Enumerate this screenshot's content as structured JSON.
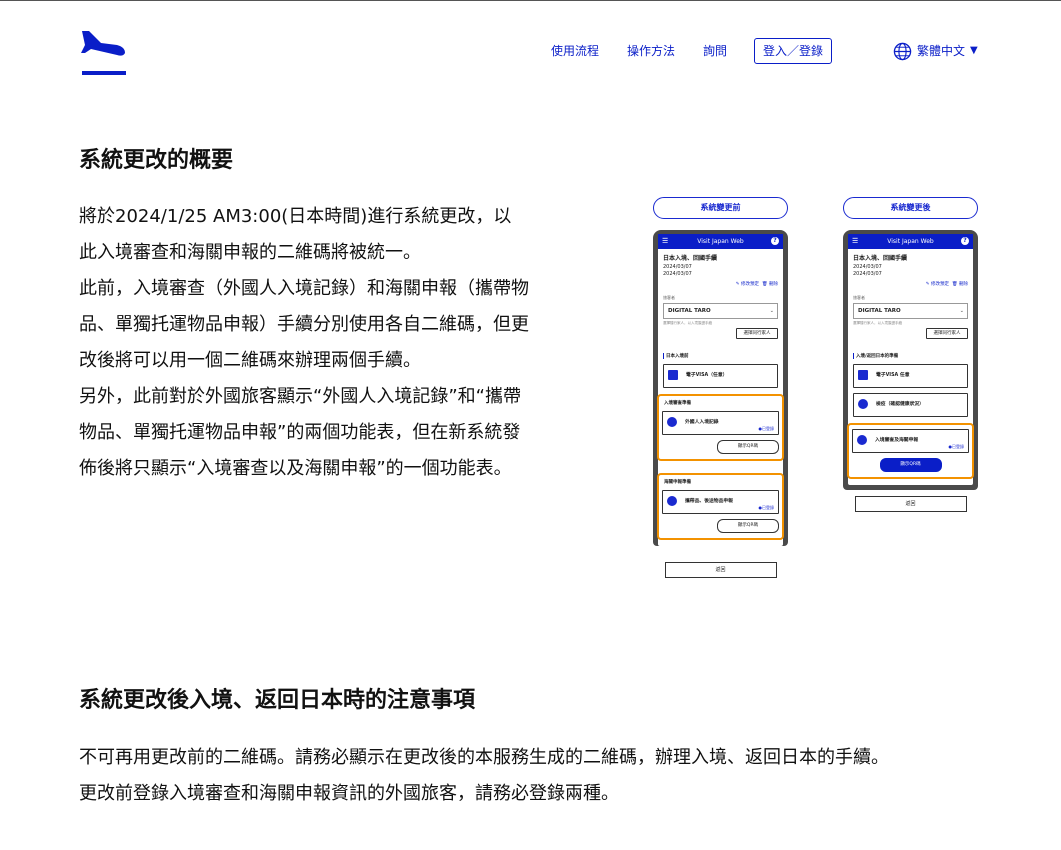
{
  "header": {
    "nav": [
      "使用流程",
      "操作方法",
      "詢問"
    ],
    "login_label": "登入／登錄",
    "language": "繁體中文"
  },
  "overview": {
    "title": "系統更改的概要",
    "paragraphs": [
      "將於2024/1/25 AM3:00(日本時間)進行系統更改，以此入境審查和海關申報的二維碼將被統一。",
      "此前，入境審查（外國人入境記錄）和海關申報（攜帶物品、單獨托運物品申報）手續分別使用各自二維碼，但更改後將可以用一個二維碼來辦理兩個手續。",
      "另外，此前對於外國旅客顯示“外國人入境記錄”和“攜帶物品、單獨托運物品申報”的兩個功能表，但在新系統發佈後將只顯示“入境審查以及海關申報”的一個功能表。"
    ]
  },
  "mockup": {
    "before_label": "系統變更前",
    "after_label": "系統變更後",
    "app_title": "Visit Japan Web",
    "trip_title": "日本入境、回國手續",
    "date1": "2024/03/07",
    "date2": "2024/03/07",
    "edit_label": "✎ 修改預定",
    "delete_label": "🗑 刪除",
    "user_label": "旅客者",
    "user_name": "DIGITAL TARO",
    "user_hint": "選擇隨行家人，以入境簽證手續",
    "companion_btn": "選擇同行家人",
    "before": {
      "section1": "日本入境前",
      "visa_card": "電子VISA（任意）",
      "section2": "入境審查準備",
      "card_immigration": "外國人入境記錄",
      "registered": "●已登錄",
      "qr_label": "顯示QR碼",
      "section3": "海關申報準備",
      "card_customs": "攜帶品、後送物品申報",
      "back": "返回"
    },
    "after": {
      "section1": "入境/返回日本的準備",
      "visa_card": "電子VISA 任意",
      "quarantine_card": "檢疫（確認健康狀況）",
      "card_combined": "入境審查及海關申報",
      "registered": "●已登錄",
      "qr_label": "顯示QR碼",
      "back": "返回"
    }
  },
  "notes": {
    "title": "系統更改後入境、返回日本時的注意事項",
    "paragraphs": [
      "不可再用更改前的二維碼。請務必顯示在更改後的本服務生成的二維碼，辦理入境、返回日本的手續。",
      "更改前登錄入境審查和海關申報資訊的外國旅客，請務必登錄兩種。"
    ]
  },
  "colors": {
    "brand": "#0a1ec8",
    "highlight": "#f39200"
  }
}
